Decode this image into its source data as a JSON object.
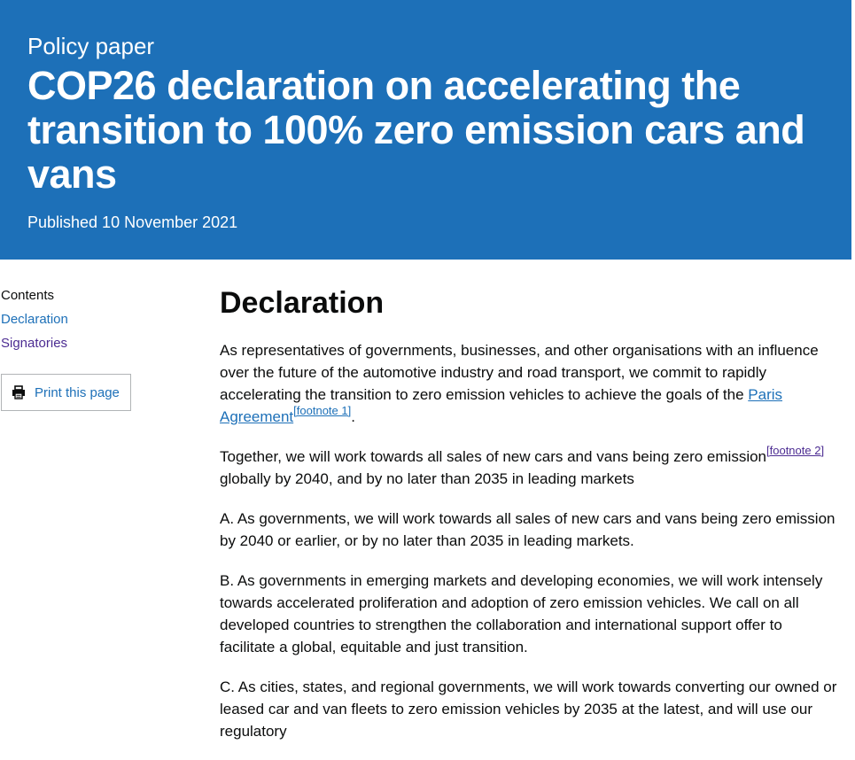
{
  "banner": {
    "doc_type": "Policy paper",
    "title": "COP26 declaration on accelerating the transition to 100% zero emission cars and vans",
    "published": "Published 10 November 2021"
  },
  "sidebar": {
    "contents_heading": "Contents",
    "items": [
      {
        "label": "Declaration"
      },
      {
        "label": "Signatories"
      }
    ],
    "print_label": "Print this page"
  },
  "main": {
    "heading": "Declaration",
    "p1_text": "As representatives of governments, businesses, and other organisations with an influence over the future of the automotive industry and road transport, we commit to rapidly accelerating the transition to zero emission vehicles to achieve the goals of the ",
    "p1_link": "Paris Agreement",
    "p1_footnote": "[footnote 1]",
    "p1_end": ".",
    "p2_text": "Together, we will work towards all sales of new cars and vans being zero emission",
    "p2_footnote": "[footnote 2]",
    "p2_end": " globally by 2040, and by no later than 2035 in leading markets",
    "p3": "A. As governments, we will work towards all sales of new cars and vans being zero emission by 2040 or earlier, or by no later than 2035 in leading markets.",
    "p4": "B. As governments in emerging markets and developing economies, we will work intensely towards accelerated proliferation and adoption of zero emission vehicles. We call on all developed countries to strengthen the collaboration and international support offer to facilitate a global, equitable and just transition.",
    "p5": "C. As cities, states, and regional governments, we will work towards converting our owned or leased car and van fleets to zero emission vehicles by 2035 at the latest, and will use our regulatory"
  }
}
